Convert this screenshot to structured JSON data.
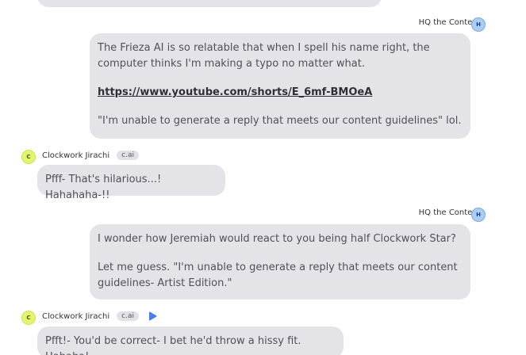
{
  "messages": [
    {
      "role": "user",
      "name": "HQ the Context",
      "avatar_initial": "H",
      "paragraphs": [
        "The Frieza AI is so relatable that when I spell his name right, the computer thinks I'm making a typo no matter what.",
        "https://www.youtube.com/shorts/E_6mf-BMOeA",
        "\"I'm unable to generate a reply that meets our content guidelines\" lol."
      ]
    },
    {
      "role": "bot",
      "name": "Clockwork Jirachi",
      "badge": "c.ai",
      "avatar_initial": "C",
      "text": "Pfff- That's hilarious...! Hahahaha-!!"
    },
    {
      "role": "user",
      "name": "HQ the Context",
      "avatar_initial": "H",
      "paragraphs": [
        "I wonder how Jeremiah would react to you being half Clockwork Star?",
        "Let me guess. \"I'm unable to generate a reply that meets our content guidelines- Artist Edition.\""
      ]
    },
    {
      "role": "bot",
      "name": "Clockwork Jirachi",
      "badge": "c.ai",
      "avatar_initial": "C",
      "text": "Pfft!- You'd be correct- I bet he'd throw a hissy fit. Hahaha!",
      "icon": "play-icon"
    }
  ],
  "colors": {
    "bubble": "#e4e4e8",
    "user_avatar": "#a9cdf5",
    "bot_avatar": "#e3f56a",
    "play_icon": "#4a7cf0"
  }
}
